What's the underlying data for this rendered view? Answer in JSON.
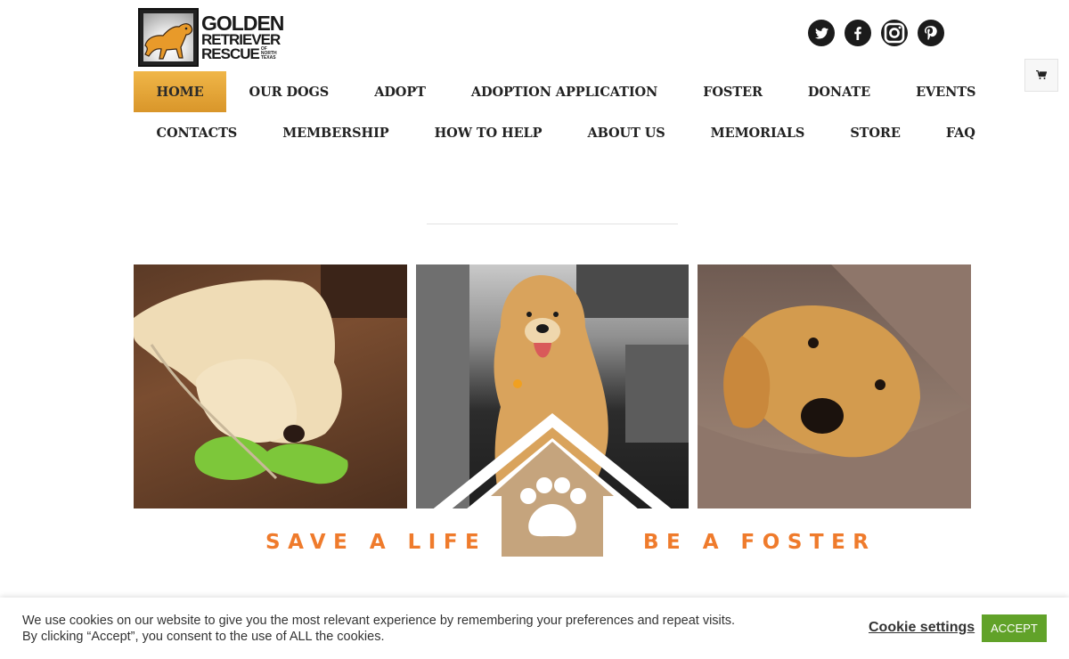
{
  "header": {
    "logo": {
      "line1": "GOLDEN",
      "line2": "RETRIEVER",
      "line3": "RESCUE",
      "sub1": "OF",
      "sub2": "NORTH",
      "sub3": "TEXAS"
    },
    "social": [
      {
        "name": "twitter-icon"
      },
      {
        "name": "facebook-icon"
      },
      {
        "name": "instagram-icon"
      },
      {
        "name": "pinterest-icon"
      }
    ],
    "cart_icon": "cart-icon"
  },
  "nav": {
    "row1": [
      "HOME",
      "OUR DOGS",
      "ADOPT",
      "ADOPTION APPLICATION",
      "FOSTER",
      "DONATE",
      "EVENTS"
    ],
    "row2": [
      "CONTACTS",
      "MEMBERSHIP",
      "HOW TO HELP",
      "ABOUT US",
      "MEMORIALS",
      "STORE",
      "FAQ"
    ],
    "active": "HOME"
  },
  "hero": {
    "slogan_left": "SAVE A LIFE",
    "slogan_right": "BE A FOSTER",
    "house_icon": "house-paw-icon"
  },
  "cookie": {
    "line1": "We use cookies on our website to give you the most relevant experience by remembering your preferences and repeat visits.",
    "line2": "By clicking “Accept”, you consent to the use of ALL the cookies.",
    "settings_label": "Cookie settings",
    "accept_label": "ACCEPT"
  },
  "colors": {
    "nav_active": "#e8a63a",
    "slogan": "#ef7b2c",
    "house": "#c5a47d",
    "accept_button": "#61a229",
    "social_bg": "#1b1b1b"
  }
}
